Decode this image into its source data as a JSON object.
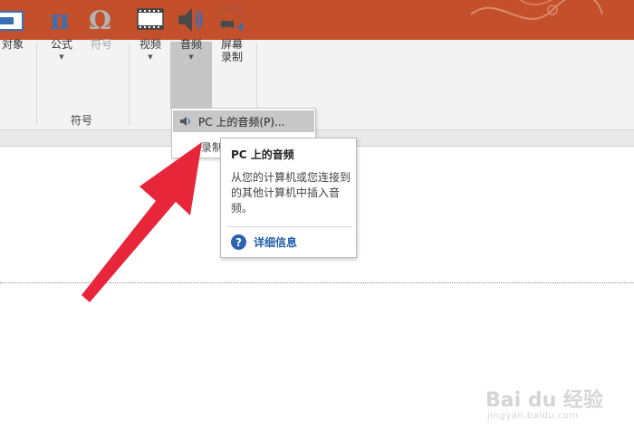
{
  "ribbon": {
    "buttons": {
      "object": "对象",
      "equation": "公式",
      "symbol": "符号",
      "video": "视频",
      "audio": "音频",
      "screen_recording_line1": "屏幕",
      "screen_recording_line2": "录制"
    },
    "groups": {
      "symbols": "符号"
    }
  },
  "menu": {
    "items": [
      {
        "label": "PC 上的音频(P)...",
        "icon": "speaker-icon"
      },
      {
        "label": "录制",
        "icon": "none"
      }
    ]
  },
  "tooltip": {
    "title": "PC 上的音频",
    "description": "从您的计算机或您连接到的其他计算机中插入音频。",
    "help_link": "详细信息",
    "help_icon": "?"
  },
  "watermark": {
    "main": "Bai du 经验",
    "sub": "jingyan.baidu.com"
  },
  "colors": {
    "title_bar": "#c3502a",
    "ribbon": "#f3f3f3",
    "equation_icon": "#3a6fb5",
    "audio_hover": "#c6c6c6",
    "arrow": "#e8263a",
    "help_link": "#1f5ea8"
  }
}
